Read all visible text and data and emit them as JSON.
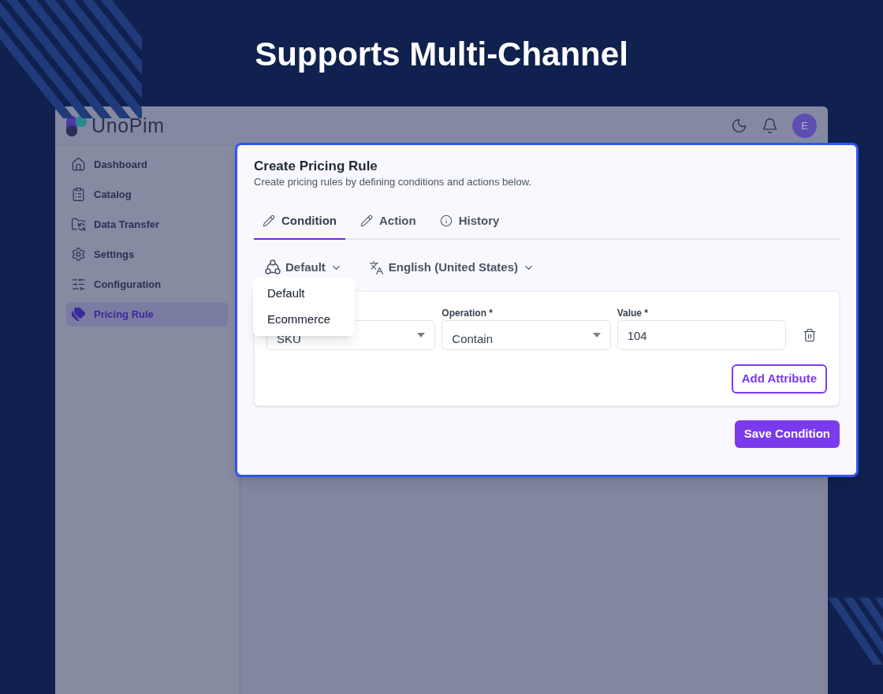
{
  "headline": "Supports Multi-Channel",
  "app": {
    "logo_text": "UnoPim",
    "avatar": "E",
    "nav": [
      {
        "label": "Dashboard",
        "selected": false
      },
      {
        "label": "Catalog",
        "selected": false
      },
      {
        "label": "Data Transfer",
        "selected": false
      },
      {
        "label": "Settings",
        "selected": false
      },
      {
        "label": "Configuration",
        "selected": false
      },
      {
        "label": "Pricing Rule",
        "selected": true
      }
    ]
  },
  "modal": {
    "title": "Create Pricing Rule",
    "subtitle": "Create pricing rules by defining conditions and actions below.",
    "tabs": [
      {
        "label": "Condition",
        "selected": true
      },
      {
        "label": "Action",
        "selected": false
      },
      {
        "label": "History",
        "selected": false
      }
    ],
    "channel": "Default",
    "locale": "English (United States)",
    "channel_menu": [
      {
        "label": "Default"
      },
      {
        "label": "Ecommerce"
      }
    ],
    "fields": [
      {
        "kind": "select",
        "value": "SKU"
      },
      {
        "kind": "select",
        "label": "Operation *",
        "value": "Contain"
      },
      {
        "kind": "input",
        "label": "Value *",
        "value": "104"
      }
    ],
    "add_button": "Add Attribute",
    "save_button": "Save Condition"
  }
}
